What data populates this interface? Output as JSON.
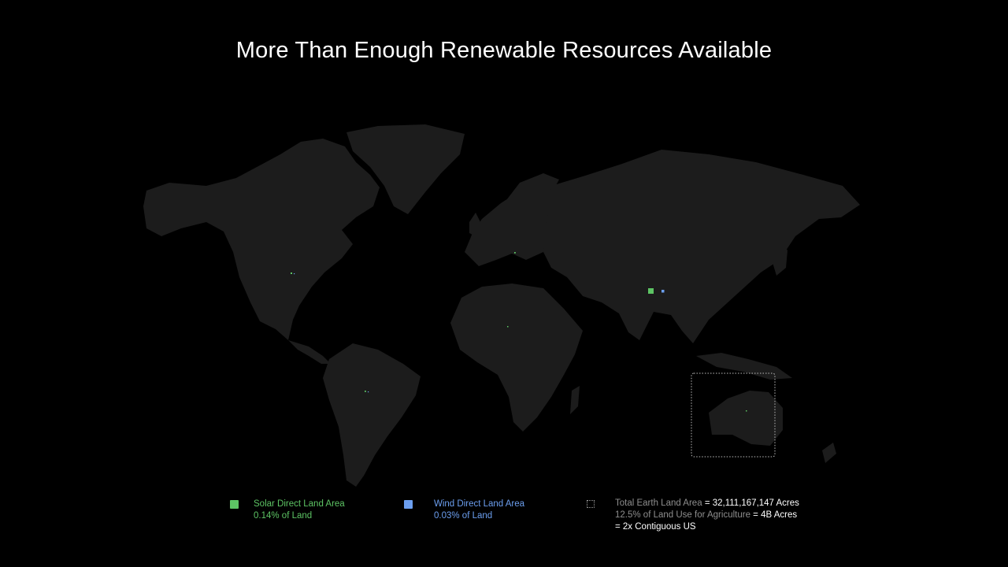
{
  "title": "More Than Enough Renewable Resources Available",
  "colors": {
    "background": "#000000",
    "land": "#1c1c1c",
    "solar": "#5dc464",
    "wind": "#6c9ff0",
    "outline": "#bdbdbd"
  },
  "legend": {
    "solar": {
      "label": "Solar Direct Land Area",
      "value": "0.14% of Land"
    },
    "wind": {
      "label": "Wind Direct Land Area",
      "value": "0.03% of Land"
    },
    "total": {
      "line1_label": "Total Earth Land Area",
      "line1_value": "= 32,111,167,147 Acres",
      "line2_label": "12.5% of Land Use for Agriculture",
      "line2_value": "= 4B Acres",
      "line3_value": "= 2x Contiguous US"
    }
  }
}
